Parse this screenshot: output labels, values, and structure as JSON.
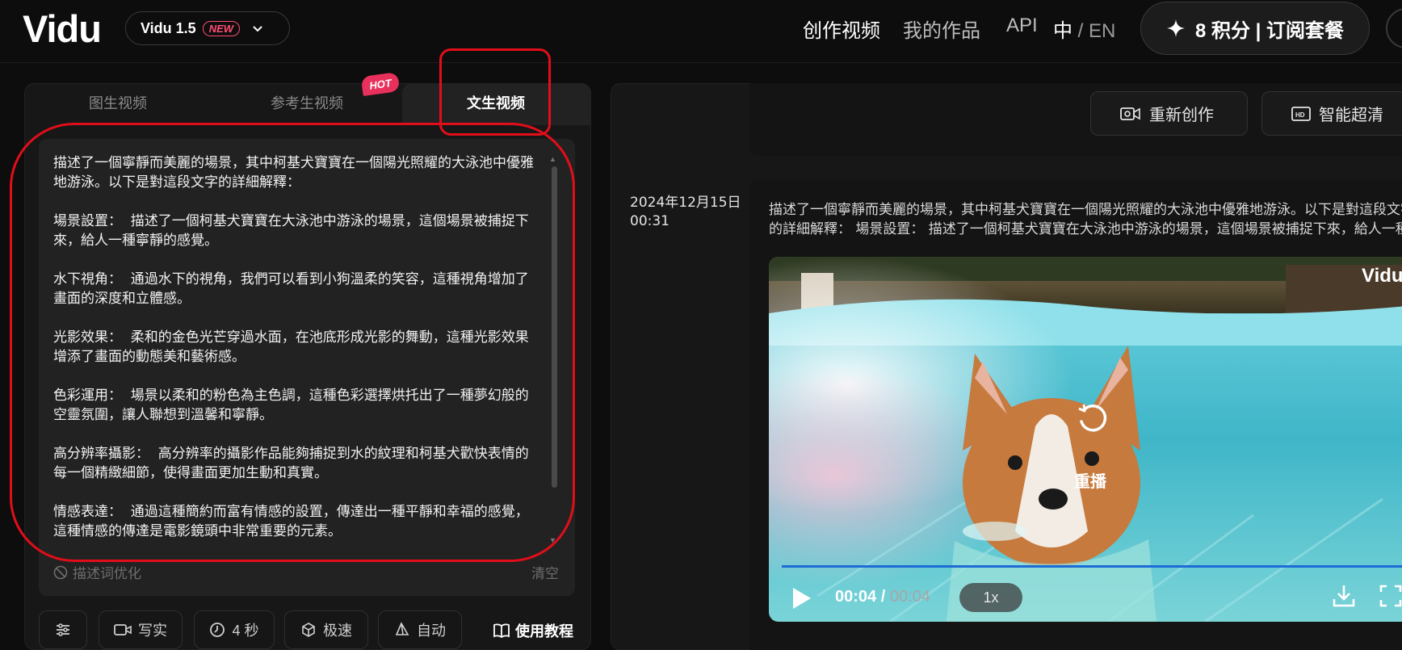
{
  "header": {
    "logo": "Vidu",
    "model": {
      "name": "Vidu 1.5",
      "badge": "NEW"
    },
    "nav": [
      "创作视频",
      "我的作品",
      "API"
    ],
    "lang_zh": "中",
    "lang_sep": " / ",
    "lang_en": "EN",
    "credits_label": "8 积分 | 订阅套餐"
  },
  "tabs": [
    "图生视频",
    "参考生视频",
    "文生视频"
  ],
  "hot_badge": "HOT",
  "prompt": {
    "text": "描述了一個寧靜而美麗的場景，其中柯基犬寶寶在一個陽光照耀的大泳池中優雅地游泳。以下是對這段文字的詳細解釋：\n\n場景設置：  描述了一個柯基犬寶寶在大泳池中游泳的場景，這個場景被捕捉下來，給人一種寧靜的感覺。\n\n水下視角：  通過水下的視角，我們可以看到小狗溫柔的笑容，這種視角增加了畫面的深度和立體感。\n\n光影效果：  柔和的金色光芒穿過水面，在池底形成光影的舞動，這種光影效果增添了畫面的動態美和藝術感。\n\n色彩運用：  場景以柔和的粉色為主色調，這種色彩選擇烘托出了一種夢幻般的空靈氛圍，讓人聯想到溫馨和寧靜。\n\n高分辨率攝影：  高分辨率的攝影作品能夠捕捉到水的紋理和柯基犬歡快表情的每一個精緻細節，使得畫面更加生動和真實。\n\n情感表達：  通過這種簡約而富有情感的設置，傳達出一種平靜和幸福的感覺，這種情感的傳達是電影鏡頭中非常重要的元素。",
    "optimize_label": "描述词优化",
    "clear_label": "清空"
  },
  "toolbar": {
    "settings_icon": "sliders-icon",
    "style_label": "写实",
    "duration_label": "4 秒",
    "speed_label": "极速",
    "auto_label": "自动",
    "tutorial_label": "使用教程"
  },
  "actions": {
    "recreate_label": "重新创作",
    "upscale_label": "智能超清"
  },
  "record": {
    "date_line1": "2024年12月15日",
    "date_line2": "00:31",
    "description": "描述了一個寧靜而美麗的場景，其中柯基犬寶寶在一個陽光照耀的大泳池中優雅地游泳。以下是對這段文字的詳細解釋：  場景設置：  描述了一個柯基犬寶寶在大泳池中游泳的場景，這個場景被捕捉下來，給人一種寧靜的感覺。",
    "description_line1": "描述了一個寧靜而美麗的場景，其中柯基犬寶寶在一個陽光照耀的大泳池中優雅地游泳。以下是對這段文字",
    "description_line2": "的詳細解釋：  場景設置：  描述了一個柯基犬寶寶在大泳池中游泳的場景，這個場景被捕捉下來，給人一種"
  },
  "video": {
    "watermark": "Vidu",
    "replay_label": "重播",
    "current_time": "00:04",
    "time_sep": " / ",
    "duration": "00:04",
    "progress": 1.0,
    "speed": "1x"
  },
  "colors": {
    "annotation_red": "#e10e1a",
    "hot_badge": "#e8305c",
    "new_badge": "#ff4d73",
    "progress_blue": "#1d6bd6"
  }
}
